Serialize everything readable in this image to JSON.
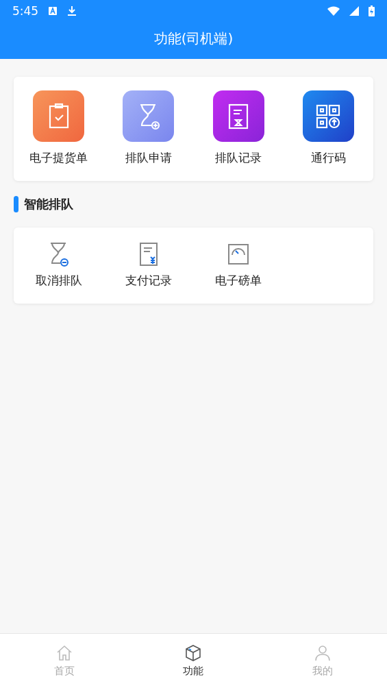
{
  "status_bar": {
    "time": "5:45"
  },
  "header": {
    "title": "功能(司机端)"
  },
  "main_functions": [
    {
      "label": "电子提货单"
    },
    {
      "label": "排队申请"
    },
    {
      "label": "排队记录"
    },
    {
      "label": "通行码"
    }
  ],
  "section": {
    "title": "智能排队"
  },
  "queue_functions": [
    {
      "label": "取消排队"
    },
    {
      "label": "支付记录"
    },
    {
      "label": "电子磅单"
    }
  ],
  "tabs": [
    {
      "label": "首页",
      "selected": false
    },
    {
      "label": "功能",
      "selected": true
    },
    {
      "label": "我的",
      "selected": false
    }
  ]
}
